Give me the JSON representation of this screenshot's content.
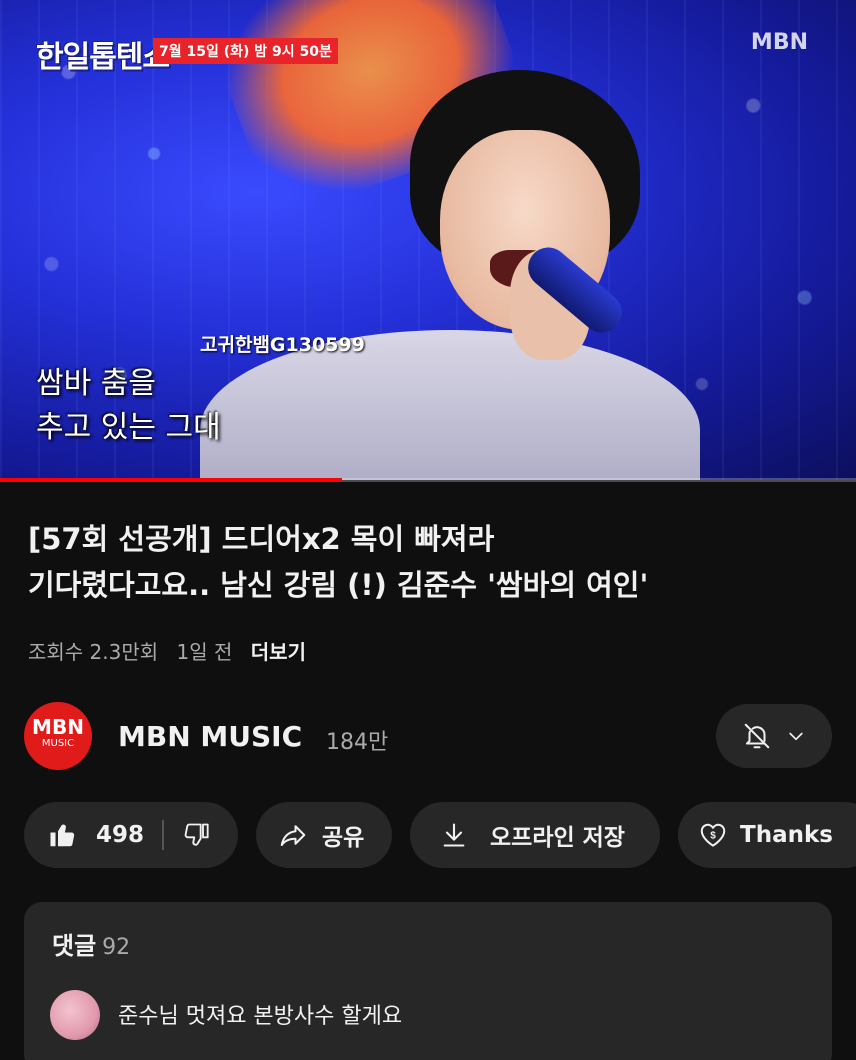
{
  "player": {
    "show_logo": "한일톱텐쇼",
    "air_time": "7월 15일 (화) 밤 9시 50분",
    "network_logo": "MBN",
    "subtitle_id": "고귀한뱀G130599",
    "subtitle_line1": "쌈바 춤을",
    "subtitle_line2": "추고 있는 그대",
    "progress_fraction": 0.4
  },
  "video": {
    "title_line1": "[57회 선공개] 드디어x2 목이 빠져라",
    "title_line2": "기다렸다고요.. 남신 강림 (!) 김준수 '쌈바의 여인'",
    "views": "조회수 2.3만회",
    "age": "1일 전",
    "more": "더보기"
  },
  "channel": {
    "avatar_text": "MBN",
    "avatar_sub": "MUSIC",
    "name": "MBN MUSIC",
    "subscribers": "184만"
  },
  "actions": {
    "likes": "498",
    "share": "공유",
    "save": "오프라인 저장",
    "thanks": "Thanks"
  },
  "comments": {
    "label": "댓글",
    "count": "92",
    "top_comment": "준수님 멋져요 본방사수 할게요"
  },
  "colors": {
    "background": "#0f0f0f",
    "pill": "#272727",
    "brand_red": "#e11a1a",
    "progress": "#ff0000"
  }
}
